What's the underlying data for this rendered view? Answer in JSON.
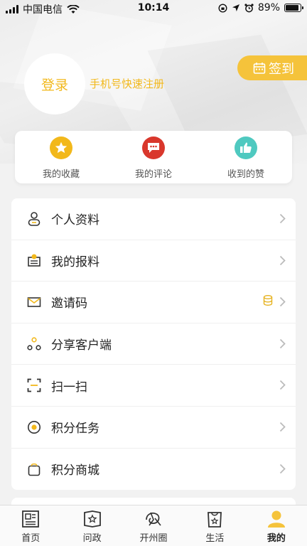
{
  "status_bar": {
    "carrier": "中国电信",
    "time": "10:14",
    "battery": "89%",
    "battery_level": 0.89
  },
  "profile": {
    "login_label": "登录",
    "register_label": "手机号快速注册",
    "checkin_label": "签到"
  },
  "quick_actions": [
    {
      "label": "我的收藏",
      "icon": "star-icon",
      "color": "#f2b81b"
    },
    {
      "label": "我的评论",
      "icon": "comment-icon",
      "color": "#d9372c"
    },
    {
      "label": "收到的赞",
      "icon": "thumbs-up-icon",
      "color": "#4fc9c0"
    }
  ],
  "menu": [
    {
      "label": "个人资料",
      "icon": "user-icon"
    },
    {
      "label": "我的报料",
      "icon": "report-icon"
    },
    {
      "label": "邀请码",
      "icon": "envelope-icon",
      "extra_icon": "coins-icon"
    },
    {
      "label": "分享客户端",
      "icon": "share-icon"
    },
    {
      "label": "扫一扫",
      "icon": "scan-icon"
    },
    {
      "label": "积分任务",
      "icon": "points-task-icon"
    },
    {
      "label": "积分商城",
      "icon": "points-mall-icon"
    }
  ],
  "tabs": [
    {
      "label": "首页",
      "icon": "newspaper-icon"
    },
    {
      "label": "问政",
      "icon": "inquiry-icon"
    },
    {
      "label": "开州圈",
      "icon": "circle-community-icon"
    },
    {
      "label": "生活",
      "icon": "life-bag-icon"
    },
    {
      "label": "我的",
      "icon": "profile-icon",
      "active": true
    }
  ],
  "colors": {
    "accent": "#f5c33b",
    "accent_text": "#f2b81b"
  }
}
